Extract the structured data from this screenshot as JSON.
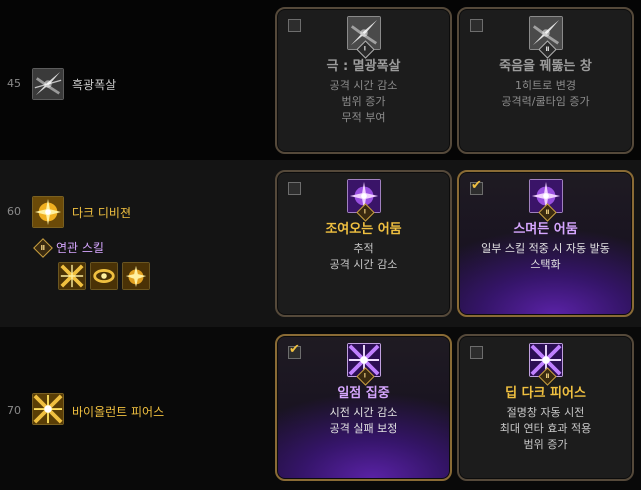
{
  "rows": [
    {
      "level": "45",
      "skill_name": "흑광폭살",
      "skill_icon": "dark-blade-icon",
      "cards": [
        {
          "selected": false,
          "rank": "Ⅰ",
          "title": "극 : 멸광폭살",
          "desc": [
            "공격 시간 감소",
            "범위 증가",
            "무적 부여"
          ]
        },
        {
          "selected": false,
          "rank": "Ⅱ",
          "title": "죽음을 꿰뚫는 창",
          "desc": [
            "1히트로 변경",
            "공격력/쿨타임 증가"
          ]
        }
      ]
    },
    {
      "level": "60",
      "skill_name": "다크 디비젼",
      "skill_icon": "gold-burst-icon",
      "related_label": "연관 스킬",
      "related_badge": "Ⅱ",
      "related_icons": [
        "gold-cross-slash-icon",
        "gold-ring-icon",
        "gold-flare-icon"
      ],
      "cards": [
        {
          "selected": false,
          "rank": "Ⅰ",
          "title": "조여오는 어둠",
          "desc": [
            "추적",
            "공격 시간 감소"
          ]
        },
        {
          "selected": true,
          "rank": "Ⅱ",
          "title": "스며든 어둠",
          "desc": [
            "일부 스킬 적중 시 자동 발동",
            "스택화"
          ]
        }
      ]
    },
    {
      "level": "70",
      "skill_name": "바이올런트 피어스",
      "skill_icon": "gold-star-burst-icon",
      "cards": [
        {
          "selected": true,
          "rank": "Ⅰ",
          "title": "일점 집중",
          "desc": [
            "시전 시간 감소",
            "공격 실패 보정"
          ]
        },
        {
          "selected": false,
          "rank": "Ⅱ",
          "title": "딥 다크 피어스",
          "desc": [
            "절명창 자동 시전",
            "최대 연타 효과 적용",
            "범위 증가"
          ]
        }
      ]
    }
  ],
  "colors": {
    "gold": "#f0c040",
    "lilac": "#d6a6ff",
    "purple_glow": "#5a22a6",
    "card_border": "#55493a",
    "card_border_selected": "#8a6b35"
  }
}
